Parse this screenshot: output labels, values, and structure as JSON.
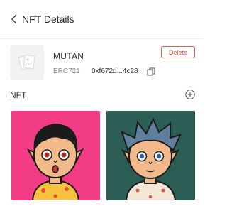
{
  "header": {
    "title": "NFT Details"
  },
  "collection": {
    "name": "MUTAN",
    "standard": "ERC721",
    "address": "0xf672d...4c28",
    "delete_label": "Delete"
  },
  "nft_section": {
    "label": "NFT"
  },
  "nfts": [
    {
      "background": "#f23d86"
    },
    {
      "background": "#2d5e55"
    }
  ],
  "colors": {
    "delete_red": "#e0504a",
    "card1_bg": "#f23d86",
    "card2_bg": "#2d5e55"
  }
}
